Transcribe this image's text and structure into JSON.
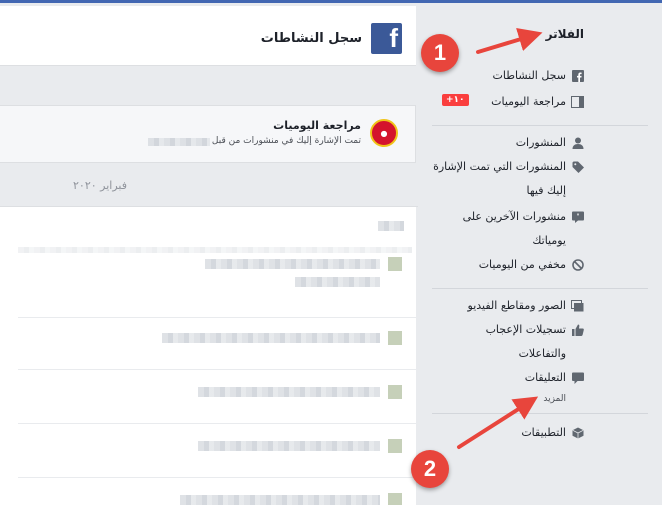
{
  "header": {
    "title": "سجل النشاطات",
    "logo": "f"
  },
  "review": {
    "title": "مراجعة اليوميات",
    "subtitle": "تمت الإشارة إليك في منشورات من قبل"
  },
  "month_label": "فبراير ٢٠٢٠",
  "sidebar": {
    "title": "الفلاتر",
    "items": [
      {
        "label": "سجل النشاطات",
        "icon": "facebook-icon"
      },
      {
        "label": "مراجعة اليوميات",
        "icon": "timeline-review-icon",
        "badge": "+١٠"
      },
      {
        "label": "المنشورات",
        "icon": "person-icon"
      },
      {
        "label": "المنشورات التي تمت الإشارة",
        "label2": "إليك فيها",
        "icon": "tag-icon"
      },
      {
        "label": "منشورات الآخرين على",
        "label2": "يومياتك",
        "icon": "quote-icon"
      },
      {
        "label": "مخفي من اليوميات",
        "icon": "hidden-icon"
      },
      {
        "label": "الصور ومقاطع الفيديو",
        "icon": "photos-icon"
      },
      {
        "label": "تسجيلات الإعجاب",
        "label2": "والتفاعلات",
        "icon": "like-icon"
      },
      {
        "label": "التعليقات",
        "icon": "comment-icon"
      },
      {
        "label": "التطبيقات",
        "icon": "apps-icon"
      }
    ],
    "more_label": "المزيد"
  },
  "annotations": [
    {
      "number": "1"
    },
    {
      "number": "2"
    }
  ],
  "colors": {
    "brand": "#3b5998",
    "annotation": "#e8453c",
    "badge": "#fa3e3e"
  }
}
